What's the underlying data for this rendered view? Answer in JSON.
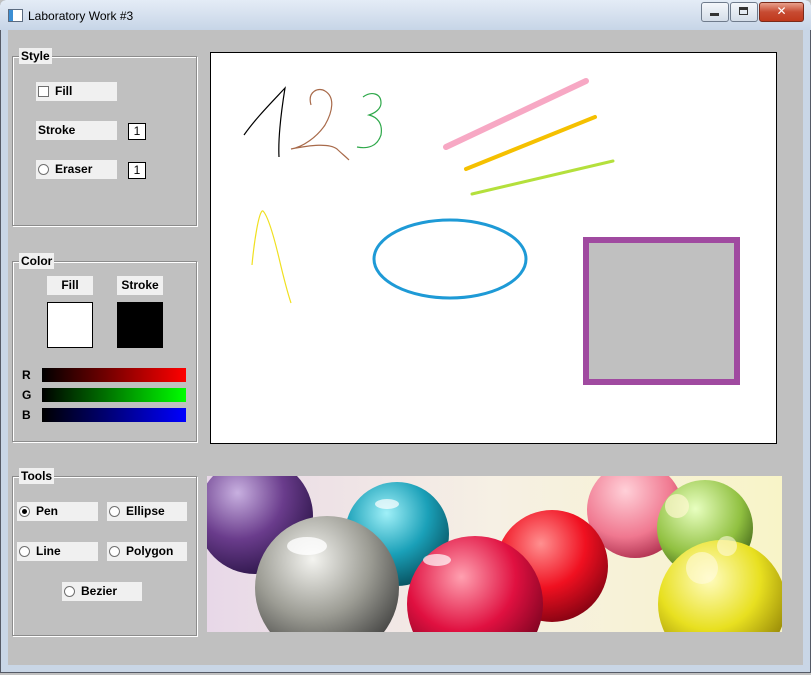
{
  "window": {
    "title": "Laboratory Work #3",
    "buttons": {
      "minimize": "_",
      "maximize": "□",
      "close": "✕"
    }
  },
  "style_group": {
    "title": "Style",
    "fill_label": "Fill",
    "fill_checked": false,
    "stroke_label": "Stroke",
    "stroke_width": "1",
    "eraser_label": "Eraser",
    "eraser_checked": false,
    "eraser_width": "1"
  },
  "color_group": {
    "title": "Color",
    "fill_label": "Fill",
    "stroke_label": "Stroke",
    "fill_color": "#ffffff",
    "stroke_color": "#000000",
    "r_label": "R",
    "g_label": "G",
    "b_label": "B"
  },
  "tools_group": {
    "title": "Tools",
    "tools": [
      {
        "label": "Pen",
        "selected": true
      },
      {
        "label": "Ellipse",
        "selected": false
      },
      {
        "label": "Line",
        "selected": false
      },
      {
        "label": "Polygon",
        "selected": false
      },
      {
        "label": "Bezier",
        "selected": false
      }
    ]
  },
  "canvas": {
    "drawn_text": [
      "1",
      "2",
      "3"
    ],
    "line_colors": [
      "#f7a8c4",
      "#f5c000",
      "#b4e03c"
    ],
    "ellipse_color": "#1e9ad6",
    "rect_stroke": "#a04aa0",
    "rect_fill": "#c0c0c0",
    "pen_stroke": "#f0e020"
  },
  "image_strip": {
    "icon": "colored-marbles-photo"
  }
}
